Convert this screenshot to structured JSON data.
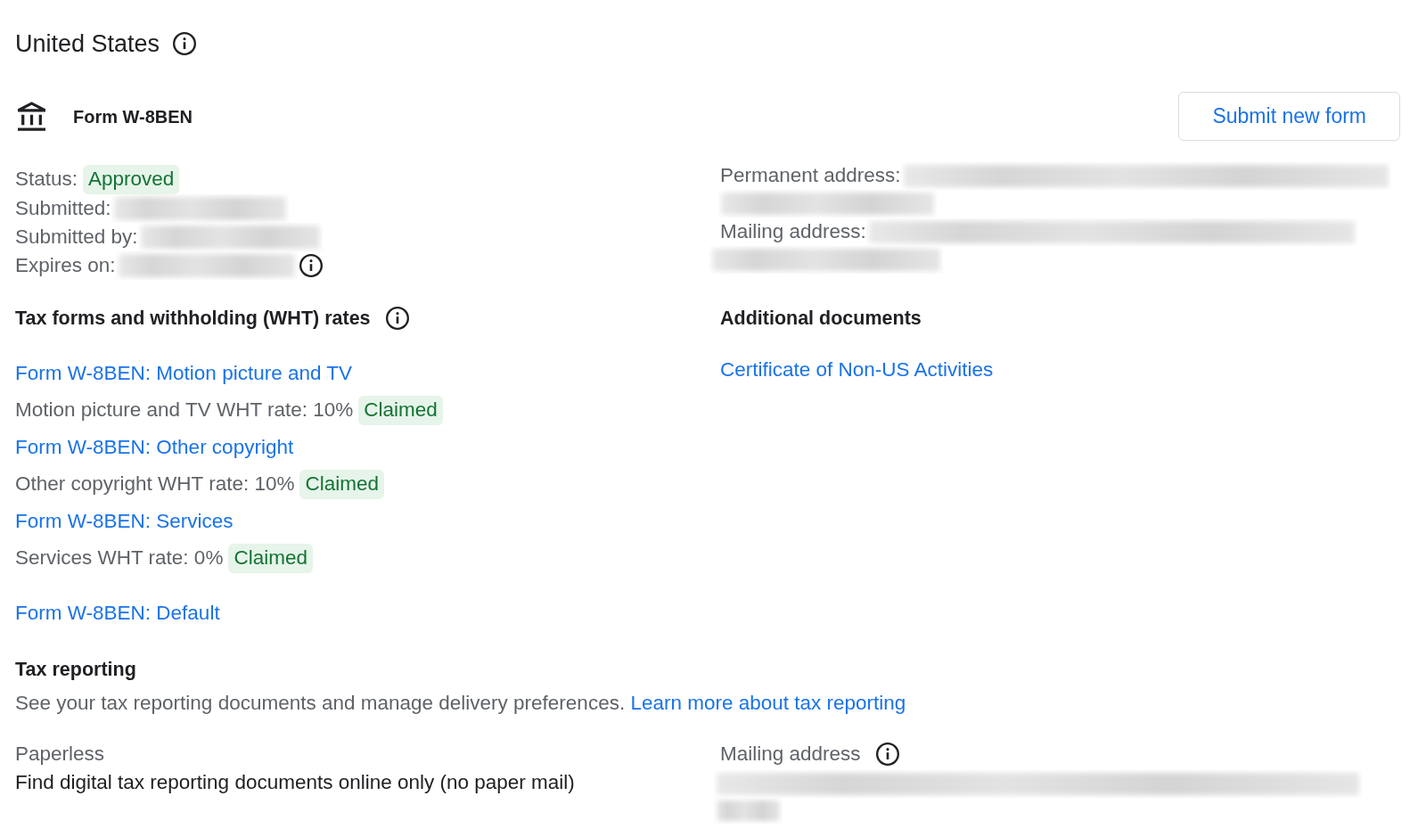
{
  "header": {
    "title": "United States"
  },
  "form": {
    "title": "Form W-8BEN",
    "button": "Submit new form"
  },
  "details": [
    {
      "label": "Status:",
      "badge": "Approved",
      "redacted": false,
      "info": false
    },
    {
      "label": "Submitted:",
      "redacted": true,
      "info": false
    },
    {
      "label": "Submitted by:",
      "redacted": true,
      "info": false
    },
    {
      "label": "Expires on:",
      "redacted": true,
      "info": true
    }
  ],
  "addresses": [
    {
      "label": "Permanent address:",
      "redacted": true
    },
    {
      "label": "Mailing address:",
      "redacted": true
    }
  ],
  "wht": {
    "title": "Tax forms and withholding (WHT) rates",
    "items": [
      {
        "link": "Form W-8BEN: Motion picture and TV",
        "rate": "Motion picture and TV WHT rate: 10%",
        "badge": "Claimed"
      },
      {
        "link": "Form W-8BEN: Other copyright",
        "rate": "Other copyright WHT rate: 10%",
        "badge": "Claimed"
      },
      {
        "link": "Form W-8BEN: Services",
        "rate": "Services WHT rate: 0%",
        "badge": "Claimed"
      },
      {
        "link": "Form W-8BEN: Default"
      }
    ]
  },
  "additional_documents": {
    "title": "Additional documents",
    "links": [
      "Certificate of Non-US Activities"
    ]
  },
  "tax_reporting": {
    "title": "Tax reporting",
    "description": "See your tax reporting documents and manage delivery preferences.",
    "link": "Learn more about tax reporting",
    "delivery": {
      "label": "Paperless",
      "value": "Find digital tax reporting documents online only (no paper mail)"
    },
    "mailing_address": {
      "label": "Mailing address",
      "redacted": true
    }
  }
}
